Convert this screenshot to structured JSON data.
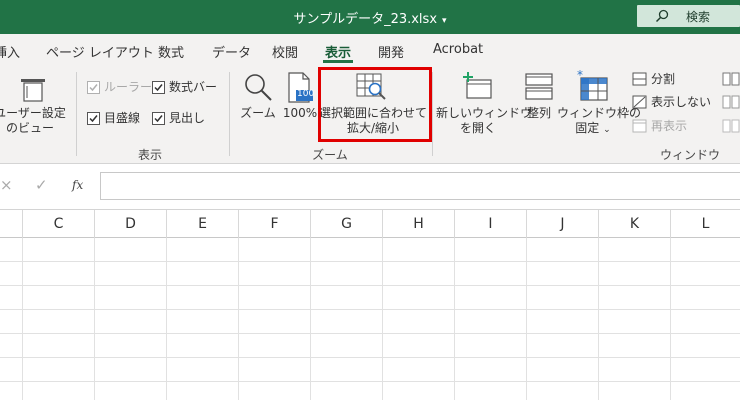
{
  "title_bar": {
    "title": "サンプルデータ_23.xlsx",
    "search_label": "検索"
  },
  "tabs": [
    {
      "label": "挿入"
    },
    {
      "label": "ページ レイアウト"
    },
    {
      "label": "数式"
    },
    {
      "label": "データ"
    },
    {
      "label": "校閲"
    },
    {
      "label": "表示",
      "active": true
    },
    {
      "label": "開発"
    },
    {
      "label": "Acrobat"
    }
  ],
  "ribbon": {
    "workbook_views": {
      "user_view_line1": "ユーザー設定",
      "user_view_line2": "のビュー"
    },
    "show": {
      "ruler": "ルーラー",
      "formula_bar": "数式バー",
      "gridlines": "目盛線",
      "headings": "見出し",
      "group_label": "表示"
    },
    "zoom": {
      "zoom": "ズーム",
      "zoom_100": "100%",
      "icon_100": "100",
      "selection_line1": "選択範囲に合わせて",
      "selection_line2": "拡大/縮小",
      "group_label": "ズーム"
    },
    "window": {
      "new_window_line1": "新しいウィンドウ",
      "new_window_line2": "を開く",
      "arrange": "整列",
      "freeze_line1": "ウィンドウ枠の",
      "freeze_line2": "固定",
      "split": "分割",
      "hide": "表示しない",
      "unhide": "再表示",
      "group_label": "ウィンドウ"
    }
  },
  "formula_bar": {
    "cancel": "×",
    "enter": "✓",
    "fx": "fx",
    "value": ""
  },
  "columns": [
    "C",
    "D",
    "E",
    "F",
    "G",
    "H",
    "I",
    "J",
    "K",
    "L"
  ],
  "colors": {
    "excel_green": "#217346",
    "highlight": "#e00000"
  }
}
